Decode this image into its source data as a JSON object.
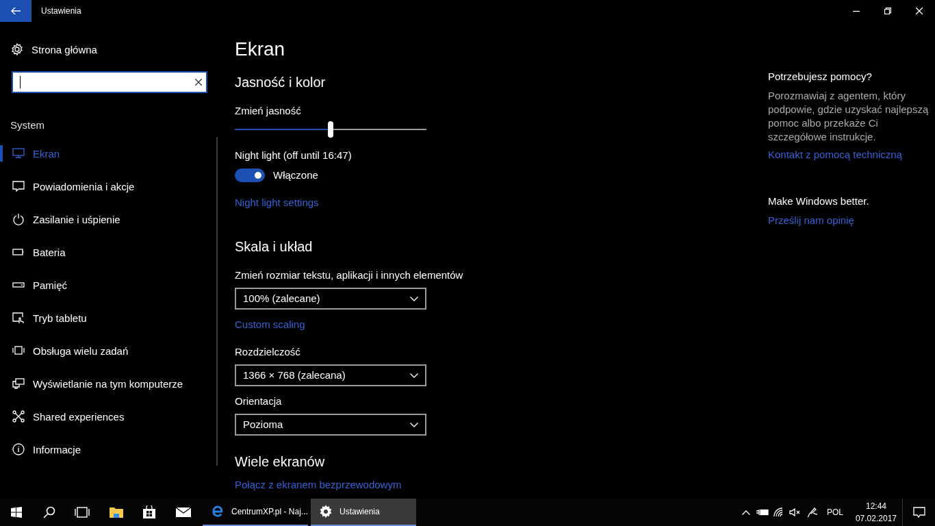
{
  "window": {
    "title": "Ustawienia"
  },
  "nav": {
    "home": "Strona główna",
    "section": "System",
    "items": [
      {
        "kind": "display",
        "label": "Ekran",
        "selected": true
      },
      {
        "kind": "notifications",
        "label": "Powiadomienia i akcje",
        "selected": false
      },
      {
        "kind": "power",
        "label": "Zasilanie i uśpienie",
        "selected": false
      },
      {
        "kind": "battery",
        "label": "Bateria",
        "selected": false
      },
      {
        "kind": "storage",
        "label": "Pamięć",
        "selected": false
      },
      {
        "kind": "tablet",
        "label": "Tryb tabletu",
        "selected": false
      },
      {
        "kind": "multitasking",
        "label": "Obsługa wielu zadań",
        "selected": false
      },
      {
        "kind": "projecting",
        "label": "Wyświetlanie na tym komputerze",
        "selected": false
      },
      {
        "kind": "shared",
        "label": "Shared experiences",
        "selected": false
      },
      {
        "kind": "about",
        "label": "Informacje",
        "selected": false
      }
    ]
  },
  "page": {
    "title": "Ekran",
    "brightness": {
      "heading": "Jasność i kolor",
      "label": "Zmień jasność",
      "level": 0.5
    },
    "night_light": {
      "label": "Night light (off until 16:47)",
      "on": true,
      "state_label": "Włączone",
      "link": "Night light settings"
    },
    "scale": {
      "heading": "Skala i układ",
      "size_label": "Zmień rozmiar tekstu, aplikacji i innych elementów",
      "size_value": "100% (zalecane)",
      "custom_link": "Custom scaling",
      "resolution_label": "Rozdzielczość",
      "resolution_value": "1366 × 768 (zalecana)",
      "orientation_label": "Orientacja",
      "orientation_value": "Pozioma"
    },
    "multi": {
      "heading": "Wiele ekranów",
      "link": "Połącz z ekranem bezprzewodowym"
    }
  },
  "help": {
    "heading": "Potrzebujesz pomocy?",
    "text": "Porozmawiaj z agentem, który podpowie, gdzie uzyskać najlepszą pomoc albo przekaże Ci szczegółowe instrukcje.",
    "link": "Kontakt z pomocą techniczną",
    "feedback_heading": "Make Windows better.",
    "feedback_link": "Prześlij nam opinię"
  },
  "taskbar": {
    "apps": [
      {
        "kind": "browser",
        "label": "CentrumXP.pl - Naj...",
        "selected": false
      },
      {
        "kind": "settings",
        "label": "Ustawienia",
        "selected": true
      }
    ],
    "language": "POL",
    "time": "12:44",
    "date": "07.02.2017"
  }
}
